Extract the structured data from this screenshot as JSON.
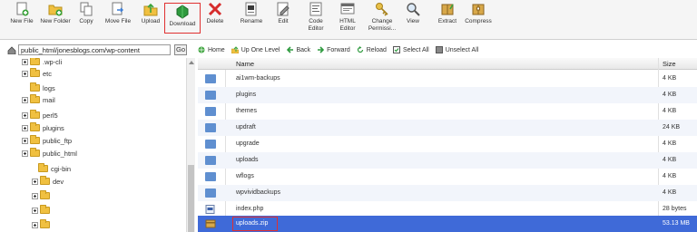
{
  "toolbar": {
    "buttons": [
      {
        "label": "New File"
      },
      {
        "label": "New Folder"
      },
      {
        "label": "Copy"
      },
      {
        "label": "Move File"
      },
      {
        "label": "Upload"
      },
      {
        "label": "Download"
      },
      {
        "label": "Delete"
      },
      {
        "label": "Rename"
      },
      {
        "label": "Edit"
      },
      {
        "label": "Code Editor"
      },
      {
        "label": "HTML Editor"
      },
      {
        "label": "Change Permissi..."
      },
      {
        "label": "View"
      },
      {
        "label": "Extract"
      },
      {
        "label": "Compress"
      }
    ]
  },
  "path": {
    "value": "public_html/jonesblogs.com/wp-content",
    "go_label": "Go"
  },
  "tree": {
    "items": [
      {
        "label": ".wp-cli",
        "expander": true
      },
      {
        "label": "etc",
        "expander": true
      },
      {
        "label": "logs",
        "expander": false
      },
      {
        "label": "mail",
        "expander": true
      },
      {
        "label": "perl5",
        "expander": true
      },
      {
        "label": "plugins",
        "expander": true
      },
      {
        "label": "public_ftp",
        "expander": true
      },
      {
        "label": "public_html",
        "expander": true
      },
      {
        "label": "cgi-bin",
        "expander": false
      },
      {
        "label": "dev",
        "expander": true
      },
      {
        "label": "",
        "expander": true
      },
      {
        "label": "",
        "expander": true
      },
      {
        "label": "",
        "expander": true
      }
    ]
  },
  "nav": {
    "home": "Home",
    "up": "Up One Level",
    "back": "Back",
    "forward": "Forward",
    "reload": "Reload",
    "select_all": "Select All",
    "unselect_all": "Unselect All"
  },
  "table": {
    "headers": {
      "name": "Name",
      "size": "Size"
    },
    "rows": [
      {
        "name": "ai1wm-backups",
        "size": "4 KB",
        "type": "folder"
      },
      {
        "name": "plugins",
        "size": "4 KB",
        "type": "folder"
      },
      {
        "name": "themes",
        "size": "4 KB",
        "type": "folder"
      },
      {
        "name": "updraft",
        "size": "24 KB",
        "type": "folder"
      },
      {
        "name": "upgrade",
        "size": "4 KB",
        "type": "folder"
      },
      {
        "name": "uploads",
        "size": "4 KB",
        "type": "folder"
      },
      {
        "name": "wflogs",
        "size": "4 KB",
        "type": "folder"
      },
      {
        "name": "wpvividbackups",
        "size": "4 KB",
        "type": "folder"
      },
      {
        "name": "index.php",
        "size": "28 bytes",
        "type": "php"
      },
      {
        "name": "uploads.zip",
        "size": "53.13 MB",
        "type": "zip",
        "selected": true
      }
    ]
  },
  "colors": {
    "selection": "#3f6ad8",
    "highlight_box": "#e03030",
    "folder_blue": "#5f8fd0",
    "folder_yellow": "#f0c040"
  }
}
